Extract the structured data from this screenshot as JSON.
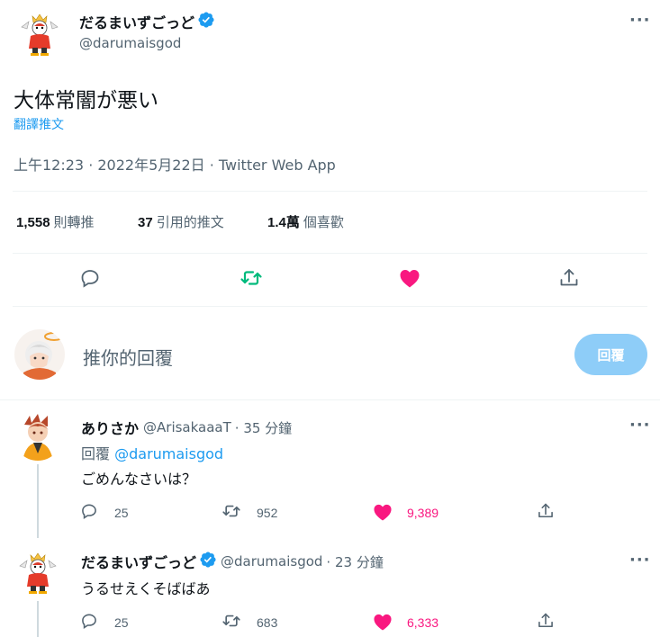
{
  "main_tweet": {
    "display_name": "だるまいずごっど",
    "handle": "@darumaisgod",
    "text": "大体常闇が悪い",
    "translate_label": "翻譯推文",
    "timestamp": "上午12:23 · 2022年5月22日 · Twitter Web App",
    "stats": {
      "retweets_count": "1,558",
      "retweets_label": "則轉推",
      "quotes_count": "37",
      "quotes_label": "引用的推文",
      "likes_count": "1.4萬",
      "likes_label": "個喜歡"
    }
  },
  "composer": {
    "placeholder": "推你的回覆",
    "reply_button": "回覆"
  },
  "replies": [
    {
      "display_name": "ありさか",
      "handle": "@ArisakaaaT",
      "time": "· 35 分鐘",
      "replying_to_label": "回覆",
      "replying_to_handle": "@darumaisgod",
      "text": "ごめんなさいは？",
      "reply_count": "25",
      "retweet_count": "952",
      "like_count": "9,389"
    },
    {
      "display_name": "だるまいずごっど",
      "handle": "@darumaisgod",
      "time": "· 23 分鐘",
      "text": "うるせえくそばばあ",
      "reply_count": "25",
      "retweet_count": "683",
      "like_count": "6,333"
    }
  ],
  "colors": {
    "accent": "#1d9bf0",
    "retweet_green": "#00ba7c",
    "like_pink": "#f91880",
    "reply_button_disabled": "#8ecdf8",
    "secondary_text": "#536471"
  }
}
